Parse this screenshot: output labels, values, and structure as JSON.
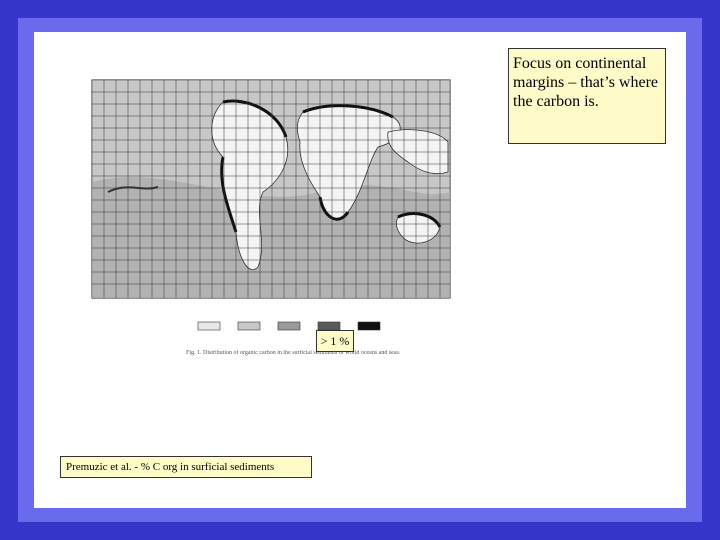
{
  "slide": {
    "note": "Focus on continental margins – that’s where the carbon is.",
    "legend_label": "> 1 %",
    "source": "Premuzic et al. - % C org in surficial sediments",
    "figure_caption": "Fig. 1. Distribution of organic carbon in the surficial sediments of world oceans and seas."
  },
  "colors": {
    "background": "#3535c8",
    "border": "#6a6aec",
    "callout_fill": "#fffbc8"
  }
}
